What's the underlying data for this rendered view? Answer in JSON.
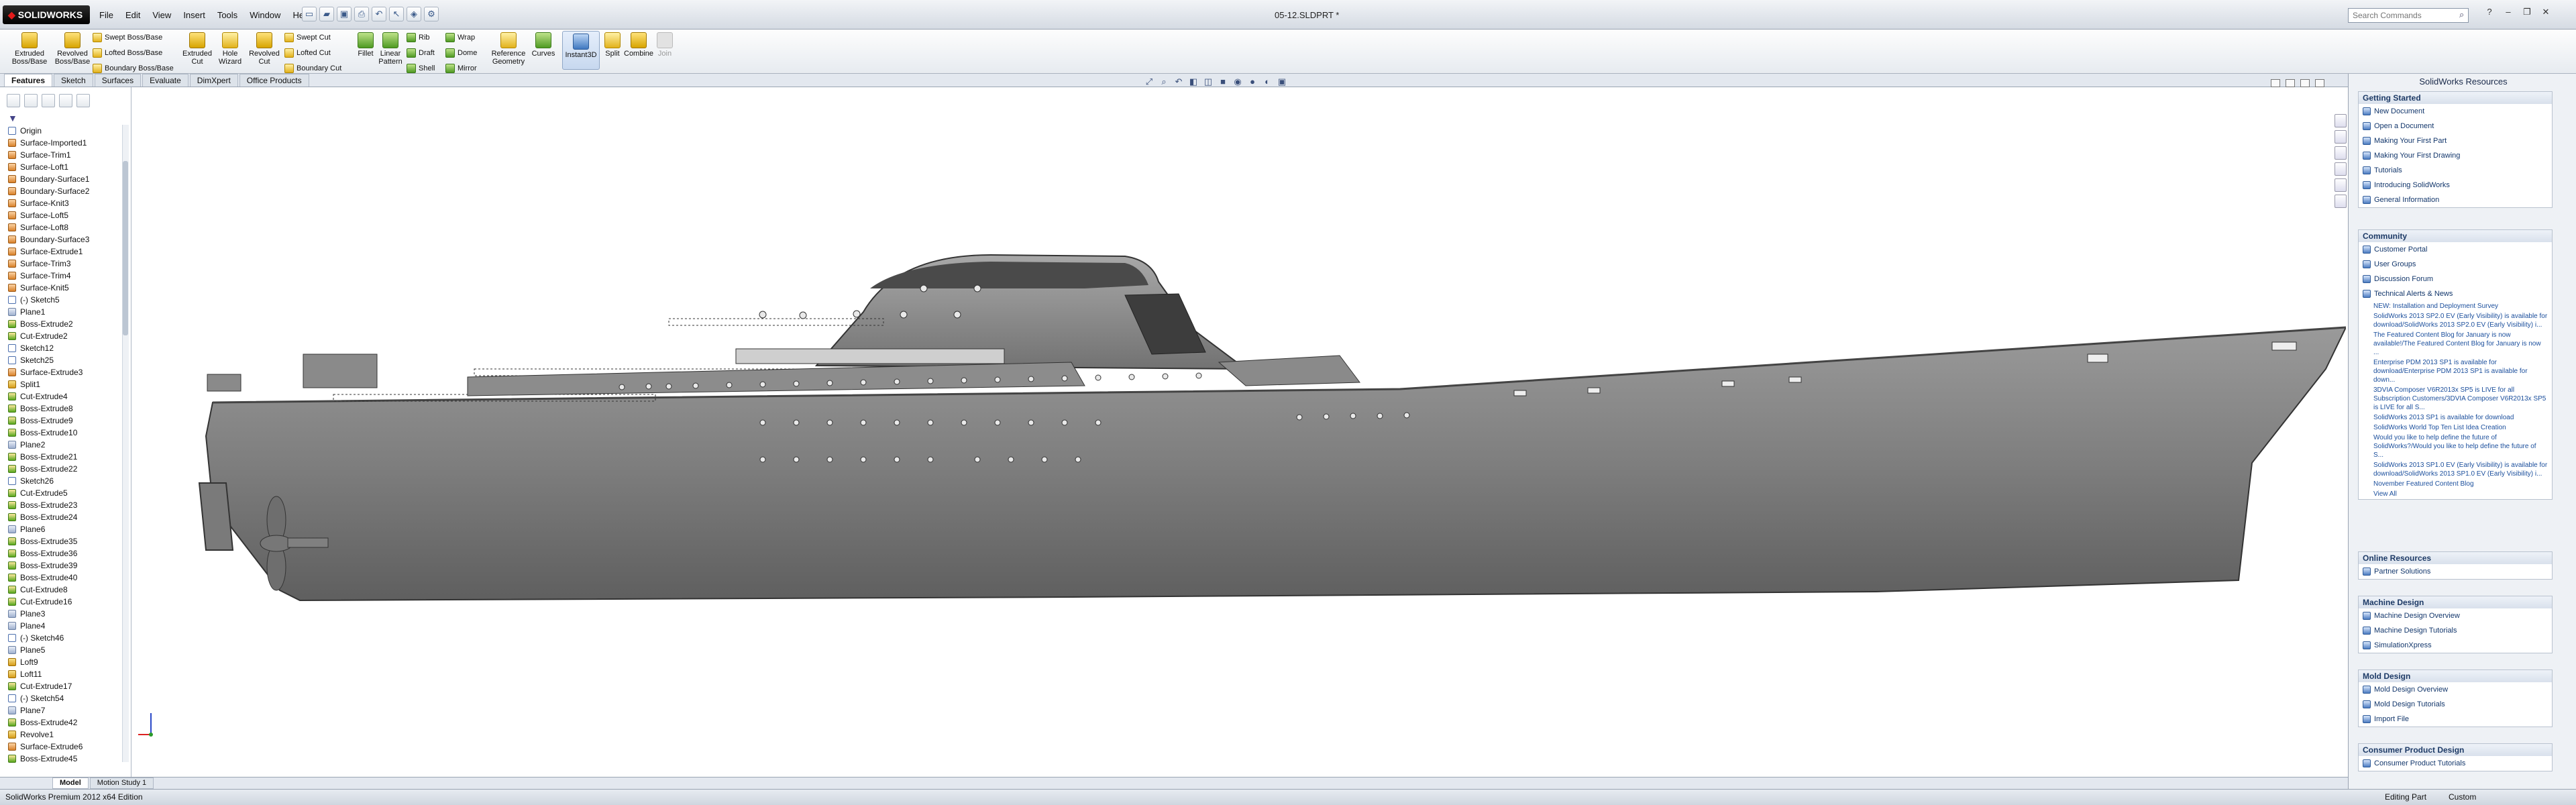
{
  "app": {
    "logo": "SOLIDWORKS",
    "document_title": "05-12.SLDPRT *"
  },
  "menu": [
    "File",
    "Edit",
    "View",
    "Insert",
    "Tools",
    "Window",
    "Help"
  ],
  "search": {
    "placeholder": "Search Commands"
  },
  "commands": {
    "extruded_boss": "Extruded Boss/Base",
    "revolved_boss": "Revolved Boss/Base",
    "swept_boss": "Swept Boss/Base",
    "lofted_boss": "Lofted Boss/Base",
    "boundary_boss": "Boundary Boss/Base",
    "extruded_cut": "Extruded Cut",
    "hole_wizard": "Hole Wizard",
    "revolved_cut": "Revolved Cut",
    "swept_cut": "Swept Cut",
    "lofted_cut": "Lofted Cut",
    "boundary_cut": "Boundary Cut",
    "fillet": "Fillet",
    "linear_pattern": "Linear Pattern",
    "rib": "Rib",
    "draft": "Draft",
    "shell": "Shell",
    "wrap": "Wrap",
    "dome": "Dome",
    "mirror": "Mirror",
    "reference_geometry": "Reference Geometry",
    "curves": "Curves",
    "instant3d": "Instant3D",
    "split": "Split",
    "combine": "Combine",
    "join": "Join"
  },
  "tabs": [
    "Features",
    "Sketch",
    "Surfaces",
    "Evaluate",
    "DimXpert",
    "Office Products"
  ],
  "tree": [
    {
      "label": "Origin",
      "t": "sketch"
    },
    {
      "label": "Surface-Imported1",
      "t": "surf"
    },
    {
      "label": "Surface-Trim1",
      "t": "surf"
    },
    {
      "label": "Surface-Loft1",
      "t": "surf"
    },
    {
      "label": "Boundary-Surface1",
      "t": "surf"
    },
    {
      "label": "Boundary-Surface2",
      "t": "surf"
    },
    {
      "label": "Surface-Knit3",
      "t": "surf"
    },
    {
      "label": "Surface-Loft5",
      "t": "surf"
    },
    {
      "label": "Surface-Loft8",
      "t": "surf"
    },
    {
      "label": "Boundary-Surface3",
      "t": "surf"
    },
    {
      "label": "Surface-Extrude1",
      "t": "surf"
    },
    {
      "label": "Surface-Trim3",
      "t": "surf"
    },
    {
      "label": "Surface-Trim4",
      "t": "surf"
    },
    {
      "label": "Surface-Knit5",
      "t": "surf"
    },
    {
      "label": "(-) Sketch5",
      "t": "sketch"
    },
    {
      "label": "Plane1",
      "t": "plane"
    },
    {
      "label": "Boss-Extrude2",
      "t": "boss"
    },
    {
      "label": "Cut-Extrude2",
      "t": "boss"
    },
    {
      "label": "Sketch12",
      "t": "sketch"
    },
    {
      "label": "Sketch25",
      "t": "sketch"
    },
    {
      "label": "Surface-Extrude3",
      "t": "surf"
    },
    {
      "label": "Split1",
      "t": "feat"
    },
    {
      "label": "Cut-Extrude4",
      "t": "boss"
    },
    {
      "label": "Boss-Extrude8",
      "t": "boss"
    },
    {
      "label": "Boss-Extrude9",
      "t": "boss"
    },
    {
      "label": "Boss-Extrude10",
      "t": "boss"
    },
    {
      "label": "Plane2",
      "t": "plane"
    },
    {
      "label": "Boss-Extrude21",
      "t": "boss"
    },
    {
      "label": "Boss-Extrude22",
      "t": "boss"
    },
    {
      "label": "Sketch26",
      "t": "sketch"
    },
    {
      "label": "Cut-Extrude5",
      "t": "boss"
    },
    {
      "label": "Boss-Extrude23",
      "t": "boss"
    },
    {
      "label": "Boss-Extrude24",
      "t": "boss"
    },
    {
      "label": "Plane6",
      "t": "plane"
    },
    {
      "label": "Boss-Extrude35",
      "t": "boss"
    },
    {
      "label": "Boss-Extrude36",
      "t": "boss"
    },
    {
      "label": "Boss-Extrude39",
      "t": "boss"
    },
    {
      "label": "Boss-Extrude40",
      "t": "boss"
    },
    {
      "label": "Cut-Extrude8",
      "t": "boss"
    },
    {
      "label": "Cut-Extrude16",
      "t": "boss"
    },
    {
      "label": "Plane3",
      "t": "plane"
    },
    {
      "label": "Plane4",
      "t": "plane"
    },
    {
      "label": "(-) Sketch46",
      "t": "sketch"
    },
    {
      "label": "Plane5",
      "t": "plane"
    },
    {
      "label": "Loft9",
      "t": "feat"
    },
    {
      "label": "Loft11",
      "t": "feat"
    },
    {
      "label": "Cut-Extrude17",
      "t": "boss"
    },
    {
      "label": "(-) Sketch54",
      "t": "sketch"
    },
    {
      "label": "Plane7",
      "t": "plane"
    },
    {
      "label": "Boss-Extrude42",
      "t": "boss"
    },
    {
      "label": "Revolve1",
      "t": "feat"
    },
    {
      "label": "Surface-Extrude6",
      "t": "surf"
    },
    {
      "label": "Boss-Extrude45",
      "t": "boss"
    }
  ],
  "bottom_tabs": [
    "Model",
    "Motion Study 1"
  ],
  "resources": {
    "title": "SolidWorks Resources",
    "getting_started": {
      "header": "Getting Started",
      "items": [
        "New Document",
        "Open a Document",
        "Making Your First Part",
        "Making Your First Drawing",
        "Tutorials",
        "Introducing SolidWorks",
        "General Information"
      ]
    },
    "community": {
      "header": "Community",
      "items": [
        "Customer Portal",
        "User Groups",
        "Discussion Forum",
        "Technical Alerts & News"
      ],
      "news": [
        "NEW: Installation and Deployment Survey",
        "SolidWorks 2013 SP2.0 EV (Early Visibility) is available for download/SolidWorks 2013 SP2.0 EV (Early Visibility) i...",
        "The Featured Content Blog for January is now available!/The Featured Content Blog for January is now ...",
        "Enterprise PDM 2013 SP1 is available for download/Enterprise PDM 2013 SP1 is available for down...",
        "3DVIA Composer V6R2013x SP5 is LIVE for all Subscription Customers/3DVIA Composer V6R2013x SP5 is LIVE for all S...",
        "SolidWorks 2013 SP1 is available for download",
        "SolidWorks World Top Ten List Idea Creation",
        "Would you like to help define the future of SolidWorks?/Would you like to help define the future of S...",
        "SolidWorks 2013 SP1.0 EV (Early Visibility) is available for download/SolidWorks 2013 SP1.0 EV (Early Visibility) i...",
        "November Featured Content Blog"
      ],
      "view_all": "View All"
    },
    "online": {
      "header": "Online Resources",
      "items": [
        "Partner Solutions"
      ]
    },
    "machine": {
      "header": "Machine Design",
      "items": [
        "Machine Design Overview",
        "Machine Design Tutorials",
        "SimulationXpress"
      ]
    },
    "mold": {
      "header": "Mold Design",
      "items": [
        "Mold Design Overview",
        "Mold Design Tutorials",
        "Import File"
      ]
    },
    "consumer": {
      "header": "Consumer Product Design",
      "items": [
        "Consumer Product Tutorials"
      ]
    }
  },
  "status": {
    "left": "SolidWorks Premium 2012 x64 Edition",
    "editing": "Editing Part",
    "units": "Custom"
  }
}
